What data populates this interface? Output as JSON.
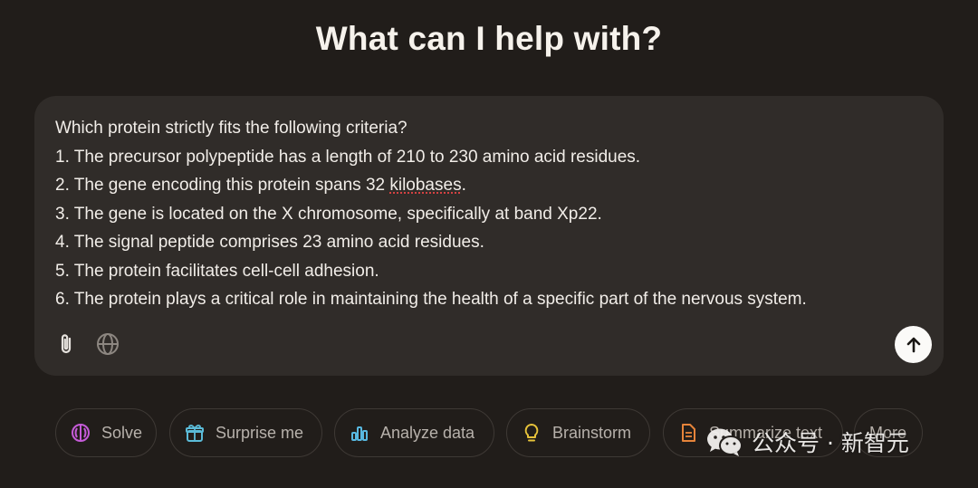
{
  "heading": "What can I help with?",
  "composer": {
    "lines": [
      "Which protein strictly fits the following criteria?",
      "1. The precursor polypeptide has a length of 210 to 230 amino acid residues.",
      "2. The gene encoding this protein spans 32 ",
      "3. The gene is located on the X chromosome, specifically at band Xp22.",
      "4. The signal peptide comprises 23 amino acid residues.",
      "5. The protein facilitates cell-cell adhesion.",
      "6. The protein plays a critical role in maintaining the health of a specific part of the nervous system."
    ],
    "misspelled_word": "kilobases",
    "line2_suffix": ".",
    "tools": {
      "attach_icon": "paperclip-icon",
      "search_icon": "globe-icon",
      "send_icon": "arrow-up-icon"
    }
  },
  "suggestions": [
    {
      "label": "Solve",
      "icon": "brain-icon",
      "color": "#c55bd8"
    },
    {
      "label": "Surprise me",
      "icon": "gift-icon",
      "color": "#5bbbd8"
    },
    {
      "label": "Analyze data",
      "icon": "bar-chart-icon",
      "color": "#58b8e0"
    },
    {
      "label": "Brainstorm",
      "icon": "lightbulb-icon",
      "color": "#e6c23a"
    },
    {
      "label": "Summarize text",
      "icon": "document-icon",
      "color": "#e6843a"
    },
    {
      "label": "More",
      "icon": "",
      "color": "#b7b1ab"
    }
  ],
  "watermark": {
    "text": "公众号 · 新智元",
    "icon": "wechat-logo-icon"
  },
  "colors": {
    "background": "#211d1a",
    "composer_bg": "#302c29",
    "text": "#f1ede8",
    "chip_border": "#3e3935",
    "chip_text": "#b7b1ab"
  }
}
